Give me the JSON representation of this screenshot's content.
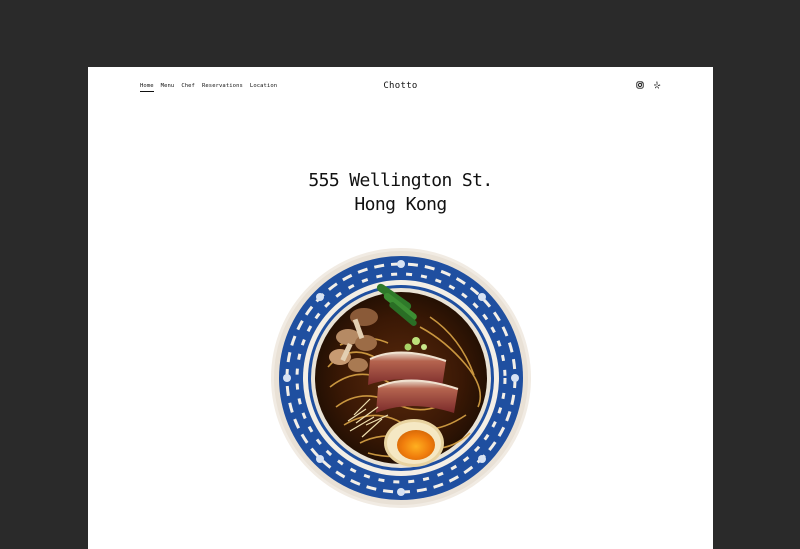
{
  "nav": {
    "items": [
      {
        "label": "Home",
        "active": true
      },
      {
        "label": "Menu",
        "active": false
      },
      {
        "label": "Chef",
        "active": false
      },
      {
        "label": "Reservations",
        "active": false
      },
      {
        "label": "Location",
        "active": false
      }
    ]
  },
  "brand": {
    "name": "Chotto"
  },
  "social": {
    "icons": [
      "instagram-icon",
      "yelp-icon"
    ]
  },
  "address": {
    "line1": "555 Wellington St.",
    "line2": "Hong Kong"
  },
  "hero": {
    "image": "ramen-bowl-illustration"
  },
  "colors": {
    "page_bg": "#2a2a2a",
    "content_bg": "#ffffff",
    "text": "#111111",
    "bowl_blue": "#1f4fa0"
  }
}
